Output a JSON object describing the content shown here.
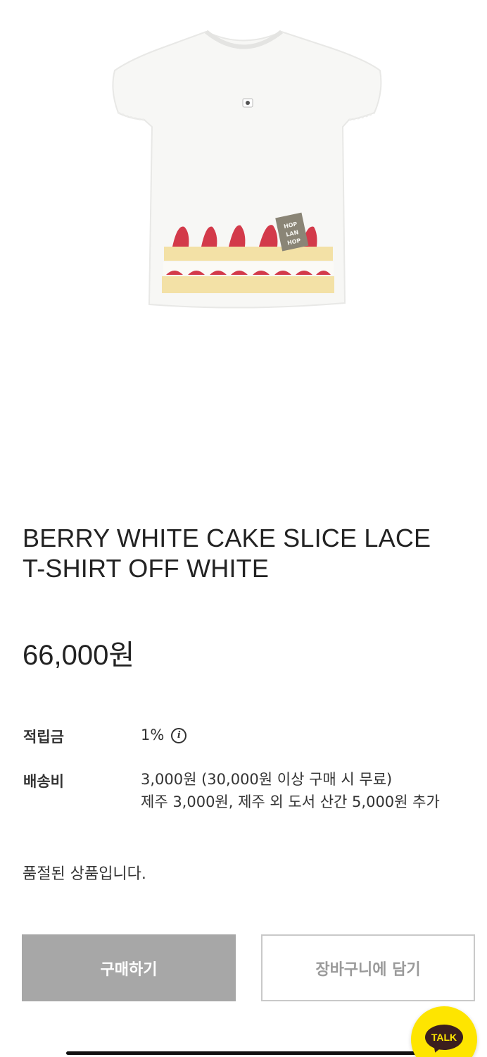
{
  "product": {
    "title": "BERRY WHITE CAKE SLICE LACE T-SHIRT OFF WHITE",
    "price": "66,000원",
    "image_label": "HOP LAN HOP"
  },
  "info": {
    "points_label": "적립금",
    "points_value": "1%",
    "points_icon": "i",
    "shipping_label": "배송비",
    "shipping_line1": "3,000원 (30,000원 이상 구매 시 무료)",
    "shipping_line2": "제주 3,000원, 제주 외 도서 산간 5,000원 추가"
  },
  "status": {
    "soldout_message": "품절된 상품입니다."
  },
  "actions": {
    "buy_label": "구매하기",
    "cart_label": "장바구니에 담기"
  },
  "chat": {
    "label": "TALK"
  },
  "colors": {
    "buy_button_bg": "#a7a7a7",
    "talk_yellow": "#fee500",
    "strawberry": "#d33a4a",
    "sponge": "#f3e1a6"
  }
}
